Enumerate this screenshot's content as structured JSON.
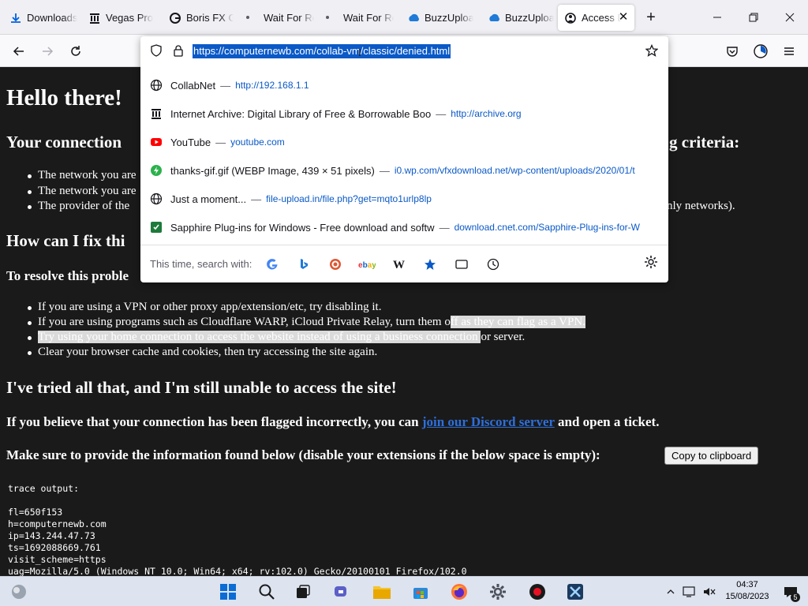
{
  "tabs": [
    {
      "title": "Downloads",
      "icon": "firefox-download-icon"
    },
    {
      "title": "Vegas Pro C",
      "icon": "archive-icon"
    },
    {
      "title": "Boris FX Ge",
      "icon": "borisfx-icon"
    },
    {
      "title": "Wait For Re",
      "icon": "dot-icon"
    },
    {
      "title": "Wait For Re",
      "icon": "dot-icon"
    },
    {
      "title": "BuzzUpload",
      "icon": "buzzupload-icon"
    },
    {
      "title": "BuzzUpload",
      "icon": "buzzupload-icon"
    },
    {
      "title": "Access D",
      "icon": "access-denied-icon",
      "active": true
    }
  ],
  "url": {
    "value": "https://computernewb.com/collab-vm/classic/denied.html"
  },
  "suggestions": [
    {
      "title": "CollabNet",
      "url": "http://192.168.1.1",
      "icon": "globe-icon"
    },
    {
      "title": "Internet Archive: Digital Library of Free & Borrowable Boo",
      "url": "http://archive.org",
      "icon": "archive-icon"
    },
    {
      "title": "YouTube",
      "url": "youtube.com",
      "icon": "youtube-icon"
    },
    {
      "title": "thanks-gif.gif (WEBP Image, 439 × 51 pixels)",
      "url": "i0.wp.com/vfxdownload.net/wp-content/uploads/2020/01/t",
      "icon": "vfx-icon"
    },
    {
      "title": "Just a moment...",
      "url": "file-upload.in/file.php?get=mqto1urlp8lp",
      "icon": "globe-icon"
    },
    {
      "title": "Sapphire Plug-ins for Windows - Free download and softw",
      "url": "download.cnet.com/Sapphire-Plug-ins-for-W",
      "icon": "cnet-icon"
    }
  ],
  "search": {
    "label": "This time, search with:",
    "engines": [
      "google",
      "bing",
      "duckduckgo",
      "ebay",
      "wikipedia",
      "bookmarks",
      "tabs",
      "history"
    ]
  },
  "page": {
    "greeting": "Hello there!",
    "connection_heading_left": "Your connection",
    "connection_heading_right": "g criteria:",
    "criteria": [
      "The network you are",
      "The network you are",
      "The provider of the",
      "nly networks)."
    ],
    "fix_heading": "How can I fix thi",
    "resolve_text": "To resolve this proble",
    "fixes": [
      {
        "pre": "If you are using a VPN or other proxy app/extension/etc, try disabling it.",
        "sel": "",
        "post": ""
      },
      {
        "pre": "If you are using programs such as Cloudflare WARP, iCloud Private Relay, turn them o",
        "sel": "ff as they can flag as a VPN.",
        "post": ""
      },
      {
        "pre": "",
        "sel": "Try using your home connection to access the website instead of using a business connection ",
        "post": "or server."
      },
      {
        "pre": "Clear your browser cache and cookies, then try accessing the site again.",
        "sel": "",
        "post": ""
      }
    ],
    "tried_heading": "I've tried all that, and I'm still unable to access the site!",
    "flagged_pre": "If you believe that your connection has been flagged incorrectly, you can ",
    "discord_link": "join our Discord server",
    "flagged_post": " and open a ticket.",
    "provide_text": "Make sure to provide the information found below (disable your extensions if the below space is empty):",
    "copy_button": "Copy to clipboard",
    "trace": [
      "trace output:",
      "",
      "fl=650f153",
      "h=computernewb.com",
      "ip=143.244.47.73",
      "ts=1692088669.761",
      "visit_scheme=https",
      "uag=Mozilla/5.0 (Windows NT 10.0; Win64; x64; rv:102.0) Gecko/20100101 Firefox/102.0"
    ]
  },
  "taskbar": {
    "time": "04:37",
    "date": "15/08/2023",
    "notifications": "5"
  }
}
